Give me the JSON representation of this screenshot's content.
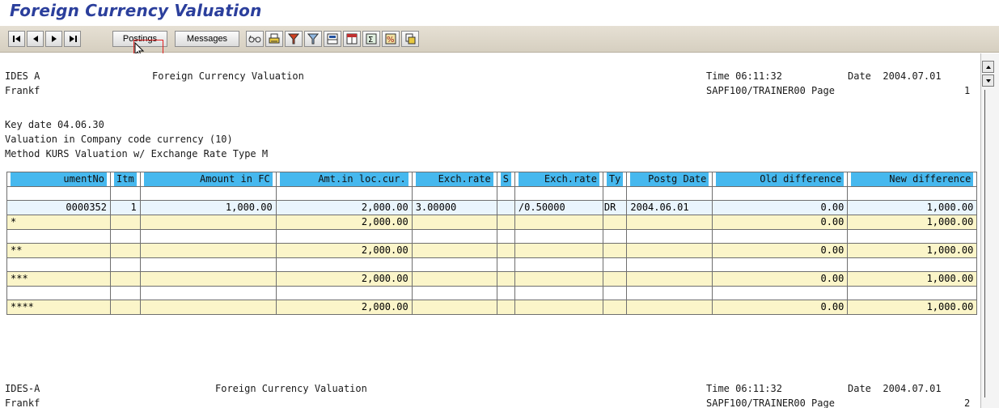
{
  "window": {
    "title": "Foreign Currency Valuation"
  },
  "toolbar": {
    "postings_label": "Postings",
    "messages_label": "Messages"
  },
  "header1": {
    "company": "IDES A",
    "report_title": "Foreign Currency Valuation",
    "time": "Time 06:11:32",
    "date": "Date  2004.07.01",
    "user": "Frankf",
    "program": "SAPF100/TRAINER00 Page",
    "page": "1"
  },
  "params": {
    "key_date": "Key date 04.06.30",
    "valuation": "Valuation in Company code currency (10)",
    "method": "Method KURS Valuation w/ Exchange Rate Type M"
  },
  "table": {
    "columns": [
      "umentNo",
      "Itm",
      "Amount in FC",
      "Amt.in loc.cur.",
      "Exch.rate",
      "S",
      "Exch.rate",
      "Ty",
      "Postg Date",
      "Old difference",
      "New difference"
    ],
    "detail": {
      "doc_no": "0000352",
      "item": "1",
      "amount_fc": "1,000.00",
      "amount_lc": "2,000.00",
      "exch_rate": "3.00000",
      "s": "",
      "exch_rate2": "/0.50000",
      "ty": "DR",
      "postg_date": "2004.06.01",
      "old_diff": "0.00",
      "new_diff": "1,000.00"
    },
    "totals": [
      {
        "label": "*",
        "amount_lc": "2,000.00",
        "old_diff": "0.00",
        "new_diff": "1,000.00"
      },
      {
        "label": "**",
        "amount_lc": "2,000.00",
        "old_diff": "0.00",
        "new_diff": "1,000.00"
      },
      {
        "label": "***",
        "amount_lc": "2,000.00",
        "old_diff": "0.00",
        "new_diff": "1,000.00"
      },
      {
        "label": "****",
        "amount_lc": "2,000.00",
        "old_diff": "0.00",
        "new_diff": "1,000.00"
      }
    ]
  },
  "header2": {
    "company": "IDES-A",
    "report_title": "Foreign Currency Valuation",
    "time": "Time 06:11:32",
    "date": "Date  2004.07.01",
    "user": "Frankf",
    "program": "SAPF100/TRAINER00 Page",
    "page": "2"
  },
  "colors": {
    "header_blue": "#46b8ee",
    "detail_row": "#eaf5fd",
    "total_row": "#fbf5c9",
    "title": "#2b3f9c"
  }
}
